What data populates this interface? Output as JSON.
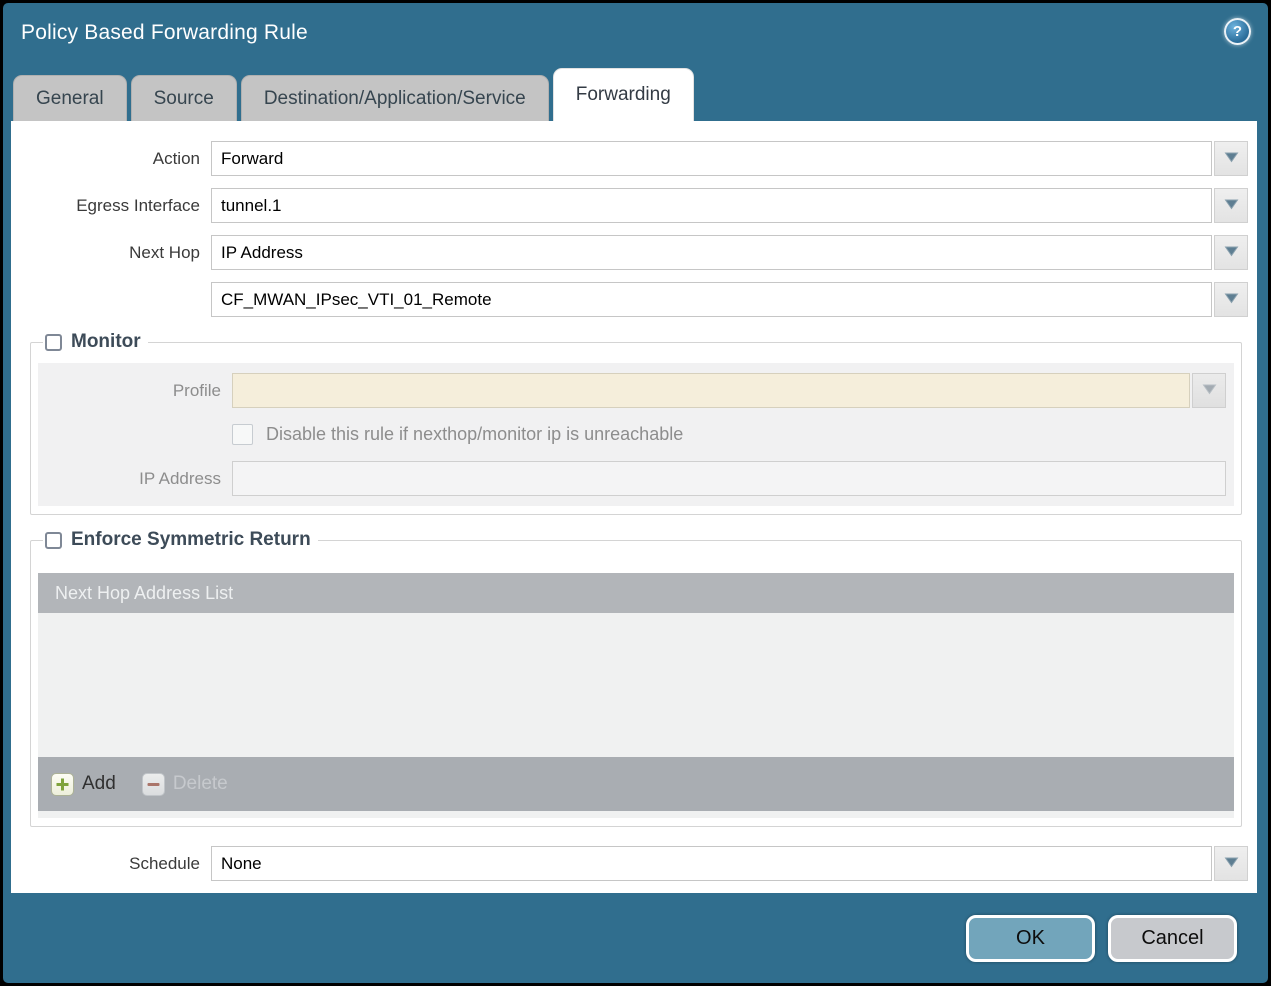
{
  "dialog": {
    "title": "Policy Based Forwarding Rule"
  },
  "icons": {
    "help": "?"
  },
  "tabs": [
    {
      "label": "General",
      "active": false
    },
    {
      "label": "Source",
      "active": false
    },
    {
      "label": "Destination/Application/Service",
      "active": false
    },
    {
      "label": "Forwarding",
      "active": true
    }
  ],
  "form": {
    "action": {
      "label": "Action",
      "value": "Forward"
    },
    "egress_interface": {
      "label": "Egress Interface",
      "value": "tunnel.1"
    },
    "next_hop": {
      "label": "Next Hop",
      "value": "IP Address"
    },
    "next_hop_value": {
      "value": "CF_MWAN_IPsec_VTI_01_Remote"
    },
    "schedule": {
      "label": "Schedule",
      "value": "None"
    }
  },
  "monitor": {
    "legend": "Monitor",
    "checked": false,
    "profile": {
      "label": "Profile",
      "value": ""
    },
    "disable_rule": {
      "label": "Disable this rule if nexthop/monitor ip is unreachable",
      "checked": false
    },
    "ip_address": {
      "label": "IP Address",
      "value": ""
    }
  },
  "esr": {
    "legend": "Enforce Symmetric Return",
    "checked": false,
    "table": {
      "header": "Next Hop Address List",
      "rows": []
    },
    "buttons": {
      "add": "Add",
      "delete": "Delete"
    },
    "delete_enabled": false
  },
  "footer": {
    "ok": "OK",
    "cancel": "Cancel"
  },
  "colors": {
    "titlebar_teal": "#306e8e",
    "tab_gray": "#c4c4c4",
    "legend_text": "#3d4b58",
    "disabled_field_cream": "#f5eedb",
    "table_header_gray": "#b2b5b9",
    "table_footer_gray": "#a9adb2",
    "add_plus_green": "#7fa33c",
    "delete_minus_red": "#aa756a",
    "ok_button_blue": "#72a5bb",
    "cancel_button_gray": "#c7c9cd",
    "dropdown_arrow": "#5e7e92"
  }
}
